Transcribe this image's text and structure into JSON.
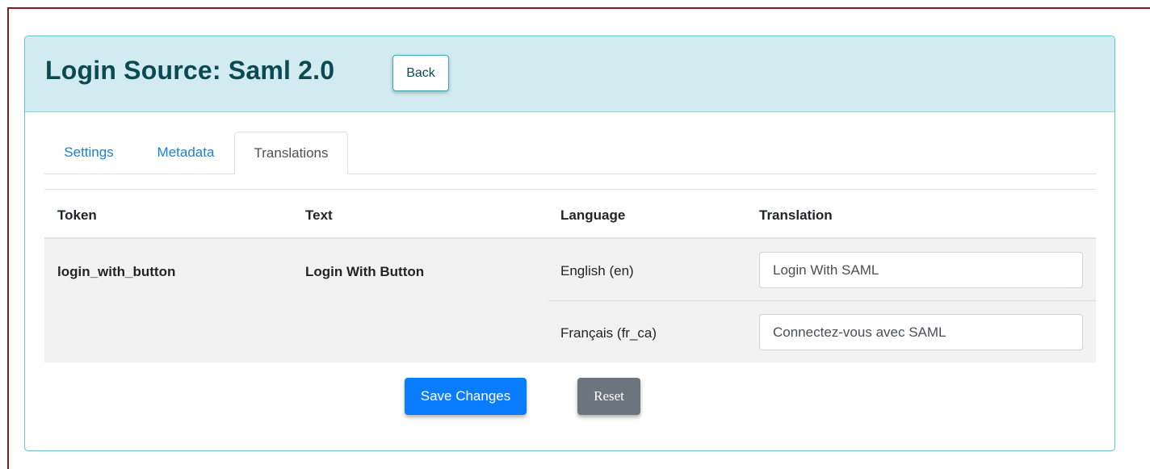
{
  "header": {
    "title": "Login Source: Saml 2.0",
    "back_label": "Back"
  },
  "tabs": [
    {
      "label": "Settings",
      "active": false
    },
    {
      "label": "Metadata",
      "active": false
    },
    {
      "label": "Translations",
      "active": true
    }
  ],
  "table": {
    "columns": [
      "Token",
      "Text",
      "Language",
      "Translation"
    ],
    "rows": [
      {
        "token": "login_with_button",
        "text": "Login With Button",
        "translations": [
          {
            "language": "English (en)",
            "value": "Login With SAML"
          },
          {
            "language": "Français (fr_ca)",
            "value": "Connectez-vous avec SAML"
          }
        ]
      }
    ]
  },
  "actions": {
    "save_label": "Save Changes",
    "reset_label": "Reset"
  },
  "colors": {
    "header_bg": "#d1ebf0",
    "title_color": "#0b4a52",
    "link_color": "#1a82d6",
    "primary": "#0a7cff",
    "secondary": "#6c757d",
    "frame_border": "#8b1a1a"
  }
}
